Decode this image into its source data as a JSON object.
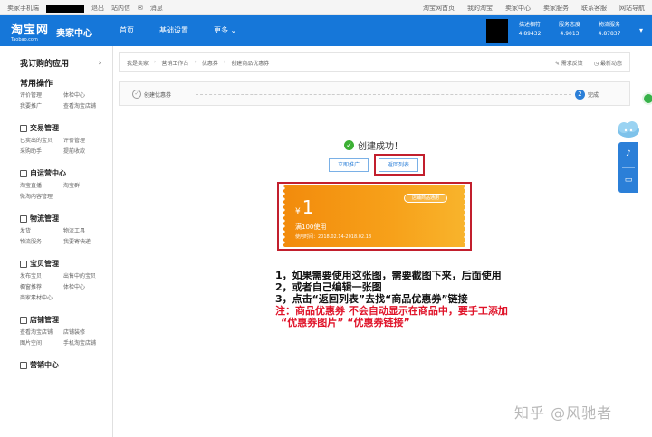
{
  "topbar": {
    "left": [
      "卖家手机端",
      "退出",
      "站内信",
      "消息"
    ],
    "right": [
      "淘宝网首页",
      "我的淘宝",
      "卖家中心",
      "卖家服务",
      "联系客服",
      "网站导航"
    ]
  },
  "header": {
    "logo_cn": "淘宝网",
    "logo_en": "Taobao.com",
    "seller_center": "卖家中心",
    "nav": [
      "首页",
      "基础设置",
      "更多"
    ],
    "stats": [
      {
        "label": "描述相符",
        "value": "4.89432"
      },
      {
        "label": "服务态度",
        "value": "4.9013"
      },
      {
        "label": "物流服务",
        "value": "4.87837"
      }
    ]
  },
  "sidebar": {
    "title": "我订购的应用",
    "sections": [
      {
        "head": "常用操作",
        "items": [
          "评价管理",
          "体检中心",
          "我要推广",
          "查看淘宝店铺"
        ]
      },
      {
        "head": "交易管理",
        "items": [
          "已卖出的宝贝",
          "评价管理",
          "采购助手",
          "提前收款"
        ]
      },
      {
        "head": "自运营中心",
        "items": [
          "淘宝直播",
          "淘宝群",
          "微淘内容管理"
        ]
      },
      {
        "head": "物流管理",
        "items": [
          "发货",
          "物流工具",
          "物流服务",
          "我要寄快递"
        ]
      },
      {
        "head": "宝贝管理",
        "items": [
          "发布宝贝",
          "出售中的宝贝",
          "橱窗推荐",
          "体检中心",
          "商家素材中心"
        ]
      },
      {
        "head": "店铺管理",
        "items": [
          "查看淘宝店铺",
          "店铺装修",
          "图片空间",
          "手机淘宝店铺"
        ]
      },
      {
        "head": "营销中心",
        "items": []
      }
    ]
  },
  "breadcrumb": [
    "我是卖家",
    "营销工作台",
    "优惠券",
    "创建商品优惠券"
  ],
  "bc_actions": [
    "需求反馈",
    "最新动态"
  ],
  "steps": {
    "step1_label": "创建优惠券",
    "step2_num": "2",
    "step2_label": "完成"
  },
  "success_text": "创建成功！",
  "buttons": {
    "promote": "立即推广",
    "back": "返回列表"
  },
  "coupon": {
    "currency": "¥",
    "amount": "1",
    "condition": "满100使用",
    "period": "使用时间：2018.02.14-2018.02.18",
    "stamp": "店铺商品通用"
  },
  "notes": {
    "line1": "1，如果需要使用这张图，需要截图下来，后面使用",
    "line2": "2，或者自己编辑一张图",
    "line3": "3，点击“返回列表”去找“商品优惠券”链接",
    "line4": "注：商品优惠券 不会自动显示在商品中，要手工添加",
    "line5": "“优惠券图片” “优惠券链接”"
  },
  "watermark": "知乎 @风驰者",
  "colors": {
    "header_blue": "#1677d9",
    "accent_red": "#c21f2d",
    "coupon_orange": "#f28b0c",
    "note_red": "#e0142a"
  }
}
